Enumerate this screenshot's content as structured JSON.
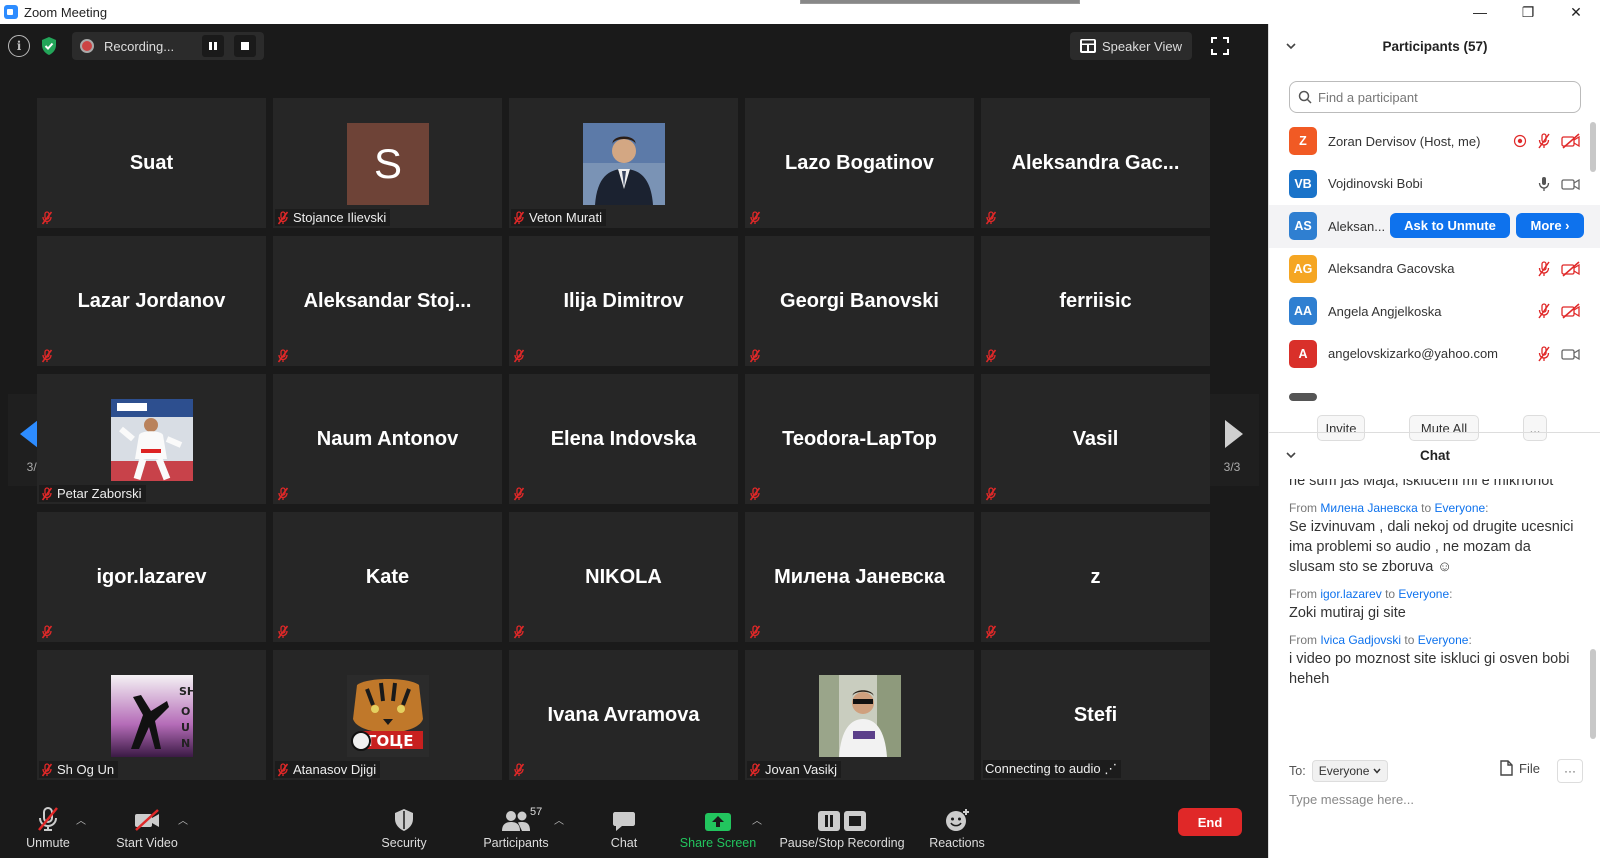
{
  "window": {
    "title": "Zoom Meeting",
    "controls": {
      "minimize": "—",
      "restore": "❐",
      "close": "✕"
    }
  },
  "topbar": {
    "recording_label": "Recording...",
    "speaker_view_label": "Speaker View"
  },
  "grid": {
    "page_left": "3/3",
    "page_right": "3/3",
    "tiles": [
      {
        "name": "Suat",
        "label": "",
        "type": "name"
      },
      {
        "name": "",
        "label": "Stojance Ilievski",
        "type": "letter",
        "letter": "S"
      },
      {
        "name": "",
        "label": "Veton Murati",
        "type": "photo",
        "photo": "suit"
      },
      {
        "name": "Lazo Bogatinov",
        "label": "",
        "type": "name"
      },
      {
        "name": "Aleksandra  Gac...",
        "label": "",
        "type": "name"
      },
      {
        "name": "Lazar Jordanov",
        "label": "",
        "type": "name"
      },
      {
        "name": "Aleksandar  Stoj...",
        "label": "",
        "type": "name"
      },
      {
        "name": "Ilija Dimitrov",
        "label": "",
        "type": "name"
      },
      {
        "name": "Georgi Banovski",
        "label": "",
        "type": "name"
      },
      {
        "name": "ferriisic",
        "label": "",
        "type": "name"
      },
      {
        "name": "",
        "label": "Petar Zaborski",
        "type": "photo",
        "photo": "karate"
      },
      {
        "name": "Naum Antonov",
        "label": "",
        "type": "name"
      },
      {
        "name": "Elena Indovska",
        "label": "",
        "type": "name"
      },
      {
        "name": "Teodora-LapTop",
        "label": "",
        "type": "name"
      },
      {
        "name": "Vasil",
        "label": "",
        "type": "name"
      },
      {
        "name": "igor.lazarev",
        "label": "",
        "type": "name"
      },
      {
        "name": "Kate",
        "label": "",
        "type": "name"
      },
      {
        "name": "NIKOLA",
        "label": "",
        "type": "name"
      },
      {
        "name": "Милена Јаневска",
        "label": "",
        "type": "name"
      },
      {
        "name": "z",
        "label": "",
        "type": "name"
      },
      {
        "name": "",
        "label": "Sh Og Un",
        "type": "photo",
        "photo": "shogun"
      },
      {
        "name": "",
        "label": "Atanasov Djigi",
        "type": "photo",
        "photo": "tiger"
      },
      {
        "name": "Ivana Avramova",
        "label": "",
        "type": "name"
      },
      {
        "name": "",
        "label": "Jovan Vasikj",
        "type": "photo",
        "photo": "man"
      },
      {
        "name": "Stefi",
        "label": "Connecting to audio ⋰",
        "type": "name",
        "no_mute": true
      }
    ]
  },
  "toolbar": {
    "unmute": "Unmute",
    "start_video": "Start Video",
    "security": "Security",
    "participants": "Participants",
    "participants_count": "57",
    "chat": "Chat",
    "share_screen": "Share Screen",
    "pause_stop_recording": "Pause/Stop Recording",
    "reactions": "Reactions",
    "end": "End"
  },
  "participants_panel": {
    "title": "Participants (57)",
    "search_placeholder": "Find a participant",
    "rows": [
      {
        "initials": "Z",
        "color": "#f15a24",
        "name": "Zoran Dervisov (Host, me)",
        "icons": [
          "rec",
          "mic-off",
          "cam-off"
        ]
      },
      {
        "initials": "VB",
        "color": "#1a73c9",
        "name": "Vojdinovski Bobi",
        "icons": [
          "mic",
          "cam"
        ]
      },
      {
        "initials": "AS",
        "color": "#2f7fd1",
        "name": "Aleksan...",
        "hover": true
      },
      {
        "initials": "AG",
        "color": "#f5a623",
        "name": "Aleksandra Gacovska",
        "icons": [
          "mic-off",
          "cam-off"
        ]
      },
      {
        "initials": "AA",
        "color": "#2f7fd1",
        "name": "Angela Angjelkoska",
        "icons": [
          "mic-off",
          "cam-off"
        ]
      },
      {
        "initials": "A",
        "color": "#d9302a",
        "name": "angelovskizarko@yahoo.com",
        "icons": [
          "mic-off",
          "cam"
        ]
      }
    ],
    "ask_to_unmute": "Ask to Unmute",
    "more": "More ›",
    "invite": "Invite",
    "mute_all": "Mute All",
    "ellipsis": "..."
  },
  "chat_panel": {
    "title": "Chat",
    "messages": [
      {
        "from": "",
        "to": "",
        "text": "ne sum jas Maja, iskluceni mi e mikrfonot"
      },
      {
        "from": "Милена Јаневска",
        "to": "Everyone",
        "text": "Se izvinuvam , dali nekoj od drugite ucesnici  ima problemi so audio , ne mozam da slusam sto se zboruva ☺"
      },
      {
        "from": "igor.lazarev",
        "to": "Everyone",
        "text": "Zoki mutiraj gi site"
      },
      {
        "from": "Ivica Gadjovski",
        "to": "Everyone",
        "text": "i video po moznost site iskluci gi osven bobi heheh"
      }
    ],
    "from_word": "From",
    "to_word": "to",
    "to_label": "To:",
    "to_value": "Everyone",
    "file_label": "File",
    "input_placeholder": "Type message here..."
  }
}
